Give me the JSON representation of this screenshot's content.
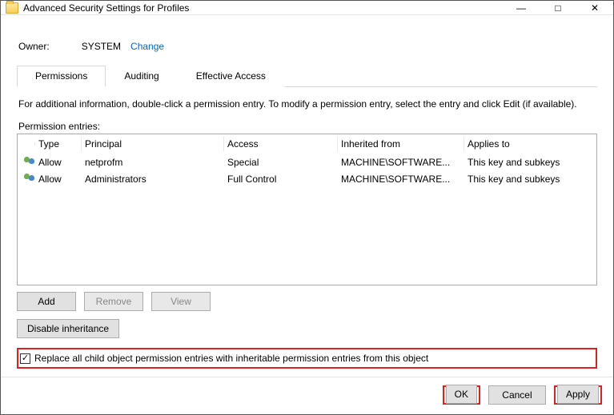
{
  "window": {
    "title": "Advanced Security Settings for Profiles"
  },
  "owner": {
    "label": "Owner:",
    "value": "SYSTEM",
    "change": "Change"
  },
  "tabs": {
    "permissions": "Permissions",
    "auditing": "Auditing",
    "effective": "Effective Access"
  },
  "info_line": "For additional information, double-click a permission entry. To modify a permission entry, select the entry and click Edit (if available).",
  "entries_label": "Permission entries:",
  "grid": {
    "headers": {
      "type": "Type",
      "principal": "Principal",
      "access": "Access",
      "inherited": "Inherited from",
      "applies": "Applies to"
    },
    "rows": [
      {
        "type": "Allow",
        "principal": "netprofm",
        "access": "Special",
        "inherited": "MACHINE\\SOFTWARE...",
        "applies": "This key and subkeys"
      },
      {
        "type": "Allow",
        "principal": "Administrators",
        "access": "Full Control",
        "inherited": "MACHINE\\SOFTWARE...",
        "applies": "This key and subkeys"
      }
    ]
  },
  "buttons": {
    "add": "Add",
    "remove": "Remove",
    "view": "View",
    "disable_inheritance": "Disable inheritance"
  },
  "checkbox": {
    "checked": true,
    "label": "Replace all child object permission entries with inheritable permission entries from this object"
  },
  "footer": {
    "ok": "OK",
    "cancel": "Cancel",
    "apply": "Apply"
  }
}
